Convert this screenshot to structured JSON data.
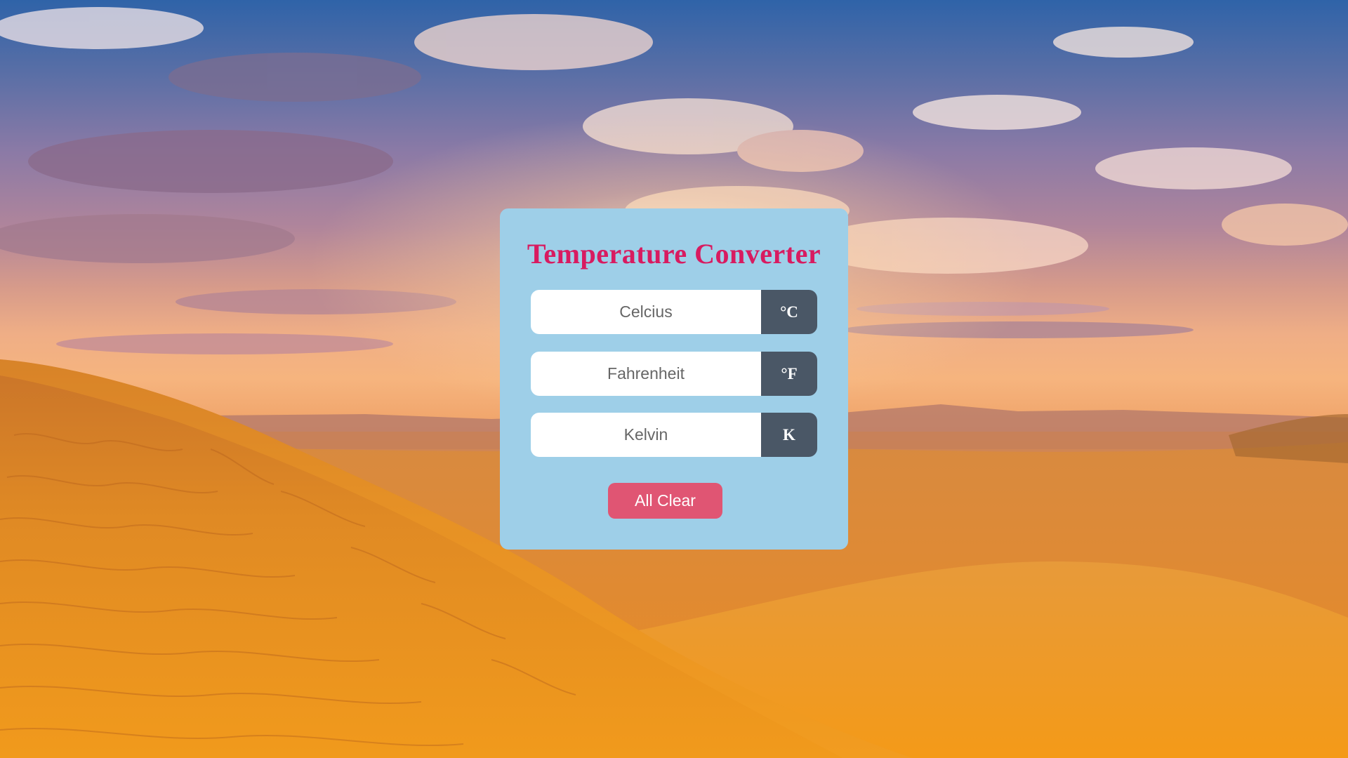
{
  "app": {
    "title": "Temperature Converter"
  },
  "fields": {
    "celsius": {
      "placeholder": "Celcius",
      "value": "",
      "unit": "°C"
    },
    "fahrenheit": {
      "placeholder": "Fahrenheit",
      "value": "",
      "unit": "°F"
    },
    "kelvin": {
      "placeholder": "Kelvin",
      "value": "",
      "unit": "K"
    }
  },
  "actions": {
    "clear_label": "All Clear"
  },
  "colors": {
    "card_bg": "#9ecfe8",
    "title": "#d81b60",
    "unit_bg": "#4a5766",
    "clear_button": "#e05573"
  },
  "background": {
    "description_icon": "desert-sunset-image"
  }
}
